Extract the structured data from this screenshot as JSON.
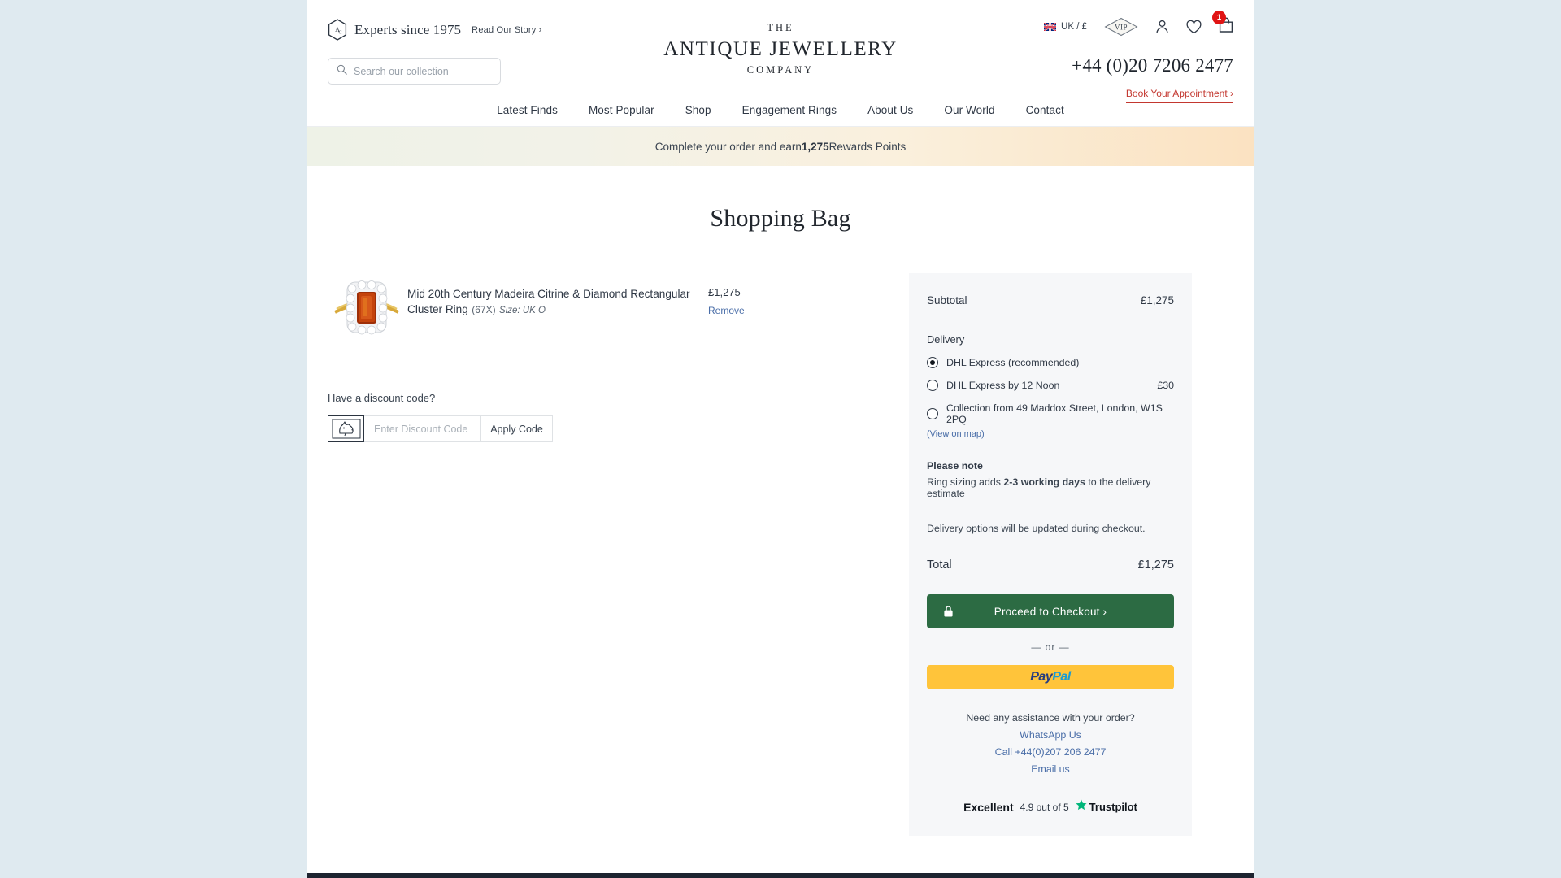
{
  "header": {
    "experts_badge_icon": "hexagon-ajc-icon",
    "experts_text": "Experts since 1975",
    "read_story_label": "Read Our Story ›",
    "search": {
      "icon": "search-icon",
      "placeholder": "Search our collection",
      "value": ""
    },
    "logo": {
      "line1": "THE",
      "line2": "ANTIQUE JEWELLERY",
      "line3": "COMPANY"
    },
    "locale": {
      "icon": "uk-flag-icon",
      "label": "UK / £"
    },
    "vip_label": "VIP",
    "account_icon": "user-icon",
    "wishlist_icon": "heart-icon",
    "cart_icon": "shopping-bag-icon",
    "cart_count": "1",
    "phone": "+44 (0)20 7206 2477",
    "appointment_label": "Book Your Appointment ›",
    "nav": [
      {
        "label": "Latest Finds"
      },
      {
        "label": "Most Popular"
      },
      {
        "label": "Shop"
      },
      {
        "label": "Engagement Rings"
      },
      {
        "label": "About Us"
      },
      {
        "label": "Our World"
      },
      {
        "label": "Contact"
      }
    ]
  },
  "rewards_banner": {
    "prefix": "Complete your order and earn ",
    "points": "1,275",
    "suffix": " Rewards Points"
  },
  "main": {
    "page_title": "Shopping Bag",
    "product": {
      "image_icon": "citrine-diamond-ring-image",
      "name": "Mid 20th Century Madeira Citrine & Diamond Rectangular Cluster Ring",
      "sku": "(67X)",
      "size": "Size: UK O",
      "price": "£1,275",
      "remove_label": "Remove"
    },
    "discount": {
      "heading": "Have a discount code?",
      "badge_icon": "dog-stamp-icon",
      "placeholder": "Enter Discount Code",
      "value": "",
      "apply_label": "Apply Code"
    }
  },
  "summary": {
    "subtotal_label": "Subtotal",
    "subtotal_value": "£1,275",
    "delivery_label": "Delivery",
    "delivery_options": [
      {
        "label": "DHL Express (recommended)",
        "price": "",
        "selected": true
      },
      {
        "label": "DHL Express by 12 Noon",
        "price": "£30",
        "selected": false
      },
      {
        "label": "Collection from 49 Maddox Street, London, W1S 2PQ",
        "price": "",
        "selected": false
      }
    ],
    "map_link_label": "(View on map)",
    "note_heading": "Please note",
    "note_prefix": "Ring sizing adds ",
    "note_bold": "2-3 working days",
    "note_suffix": " to the delivery estimate",
    "note_alt": "Delivery options will be updated during checkout.",
    "total_label": "Total",
    "total_value": "£1,275",
    "checkout_label": "Proceed to Checkout ›",
    "checkout_icon": "lock-icon",
    "or_label": "— or —",
    "paypal_pay": "Pay",
    "paypal_pal": "Pal",
    "assist_heading": "Need any assistance with your order?",
    "assist_links": [
      {
        "label": "WhatsApp Us"
      },
      {
        "label": "Call +44(0)207 206 2477"
      },
      {
        "label": "Email us"
      }
    ],
    "trustpilot": {
      "rating_word": "Excellent",
      "score": "4.9 out of 5",
      "star_icon": "trustpilot-star-icon",
      "brand": "Trustpilot"
    }
  },
  "colors": {
    "page_bg_outer": "#dfeaf0",
    "accent_red": "#c3372f",
    "checkout_green": "#2c6b43",
    "paypal_yellow": "#ffc43a",
    "link_blue": "#4a6ea8",
    "summary_bg": "#f6f7f9",
    "trustpilot_green": "#00b67a"
  }
}
